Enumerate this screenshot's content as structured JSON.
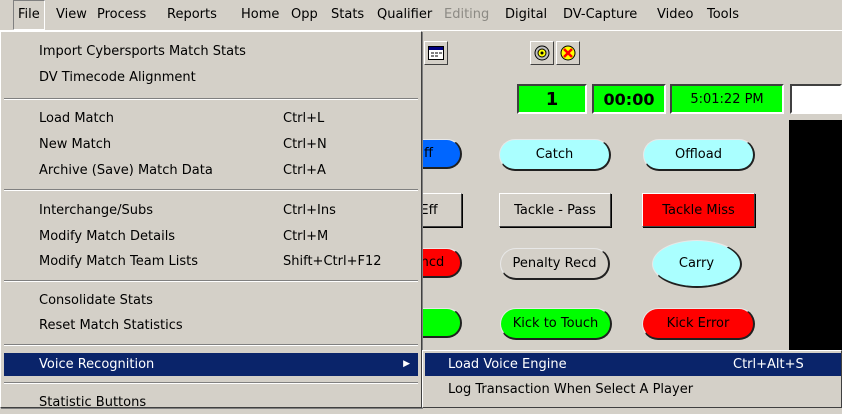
{
  "menubar": {
    "items": [
      "File",
      "View",
      "Process",
      "Reports",
      "Home",
      "Opp",
      "Stats",
      "Qualifier",
      "Editing",
      "Digital",
      "DV-Capture",
      "Video",
      "Tools"
    ],
    "open_item": "File",
    "disabled_item": "Editing"
  },
  "file_menu": {
    "items": [
      {
        "label": "Import Cybersports Match Stats",
        "shortcut": ""
      },
      {
        "label": "DV Timecode Alignment",
        "shortcut": ""
      },
      {
        "label": "Load Match",
        "shortcut": "Ctrl+L"
      },
      {
        "label": "New Match",
        "shortcut": "Ctrl+N"
      },
      {
        "label": "Archive (Save) Match Data",
        "shortcut": "Ctrl+A"
      },
      {
        "label": "Interchange/Subs",
        "shortcut": "Ctrl+Ins"
      },
      {
        "label": "Modify Match Details",
        "shortcut": "Ctrl+M"
      },
      {
        "label": "Modify Match Team Lists",
        "shortcut": "Shift+Ctrl+F12"
      },
      {
        "label": "Consolidate Stats",
        "shortcut": ""
      },
      {
        "label": "Reset Match Statistics",
        "shortcut": ""
      },
      {
        "label": "Voice Recognition",
        "shortcut": ""
      },
      {
        "label": "Statistic Buttons",
        "shortcut": ""
      }
    ],
    "highlighted": "Voice Recognition"
  },
  "submenu": {
    "items": [
      {
        "label": "Load Voice Engine",
        "shortcut": "Ctrl+Alt+S"
      },
      {
        "label": "Log Transaction When Select A Player",
        "shortcut": ""
      }
    ],
    "highlighted": "Load Voice Engine"
  },
  "toolbar": {
    "icons": [
      "calendar-icon",
      "disc-icon",
      "stop-disc-icon"
    ]
  },
  "status": {
    "period": "1",
    "clock": "00:00",
    "time": "5:01:22 PM"
  },
  "stat_buttons": {
    "r1_partial": "ff",
    "catch": "Catch",
    "offload": "Offload",
    "r2_partial": "Eff",
    "tackle_pass": "Tackle - Pass",
    "tackle_miss": "Tackle Miss",
    "r3_partial": "oncd",
    "penalty_recd": "Penalty Recd",
    "carry": "Carry",
    "kick_to_touch": "Kick to Touch",
    "kick_error": "Kick Error"
  },
  "colors": {
    "face": "#d4d0c8",
    "highlight": "#0a246a",
    "cyan": "#aaffff",
    "blue": "#0066ff",
    "red": "#ff0000",
    "green": "#00ff00",
    "status_green": "#00ff00"
  }
}
